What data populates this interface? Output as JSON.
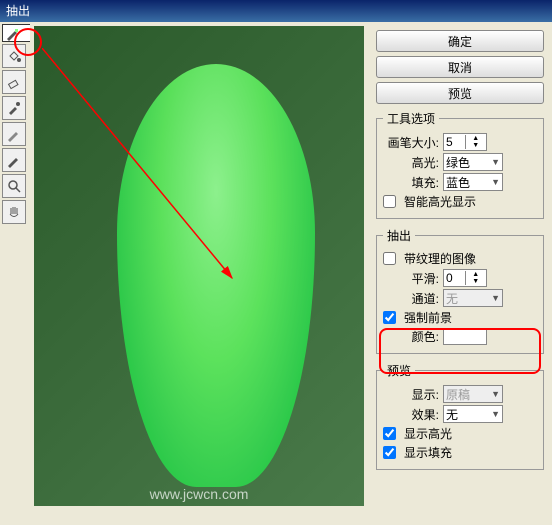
{
  "title": "抽出",
  "buttons": {
    "ok": "确定",
    "cancel": "取消",
    "preview": "预览"
  },
  "toolOptions": {
    "legend": "工具选项",
    "brushLabel": "画笔大小:",
    "brushValue": "5",
    "highlightLabel": "高光:",
    "highlightValue": "绿色",
    "fillLabel": "填充:",
    "fillValue": "蓝色",
    "smartLabel": "智能高光显示",
    "smartChecked": false
  },
  "extract": {
    "legend": "抽出",
    "texturedLabel": "带纹理的图像",
    "texturedChecked": false,
    "smoothLabel": "平滑:",
    "smoothValue": "0",
    "channelLabel": "通道:",
    "channelValue": "无",
    "forceFgLabel": "强制前景",
    "forceFgChecked": true,
    "colorLabel": "颜色:"
  },
  "preview": {
    "legend": "预览",
    "showLabel": "显示:",
    "showValue": "原稿",
    "effectLabel": "效果:",
    "effectValue": "无",
    "showHighlightLabel": "显示高光",
    "showHighlightChecked": true,
    "showFillLabel": "显示填充",
    "showFillChecked": true
  },
  "watermark": "www.jcwcn.com"
}
